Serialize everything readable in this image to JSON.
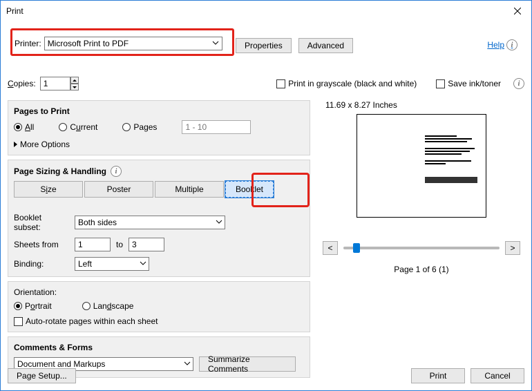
{
  "window": {
    "title": "Print"
  },
  "header": {
    "printer_label": "Printer:",
    "printer_value": "Microsoft Print to PDF",
    "properties": "Properties",
    "advanced": "Advanced",
    "help": "Help"
  },
  "copies": {
    "label": "Copies:",
    "value": "1",
    "grayscale": "Print in grayscale (black and white)",
    "save_ink": "Save ink/toner"
  },
  "pages_panel": {
    "title": "Pages to Print",
    "all": "All",
    "current": "Current",
    "pages": "Pages",
    "range_placeholder": "1 - 10",
    "more": "More Options"
  },
  "sizing_panel": {
    "title": "Page Sizing & Handling",
    "size": "Size",
    "poster": "Poster",
    "multiple": "Multiple",
    "booklet": "Booklet",
    "subset_label": "Booklet subset:",
    "subset_value": "Both sides",
    "sheets_label": "Sheets from",
    "sheets_from": "1",
    "to_label": "to",
    "sheets_to": "3",
    "binding_label": "Binding:",
    "binding_value": "Left"
  },
  "orientation": {
    "title": "Orientation:",
    "portrait": "Portrait",
    "landscape": "Landscape",
    "auto_rotate": "Auto-rotate pages within each sheet"
  },
  "comments": {
    "title": "Comments & Forms",
    "value": "Document and Markups",
    "summarize": "Summarize Comments"
  },
  "preview": {
    "dimensions": "11.69 x 8.27 Inches",
    "prev": "<",
    "next": ">",
    "page_indicator": "Page 1 of 6 (1)"
  },
  "footer": {
    "page_setup": "Page Setup...",
    "print": "Print",
    "cancel": "Cancel"
  }
}
